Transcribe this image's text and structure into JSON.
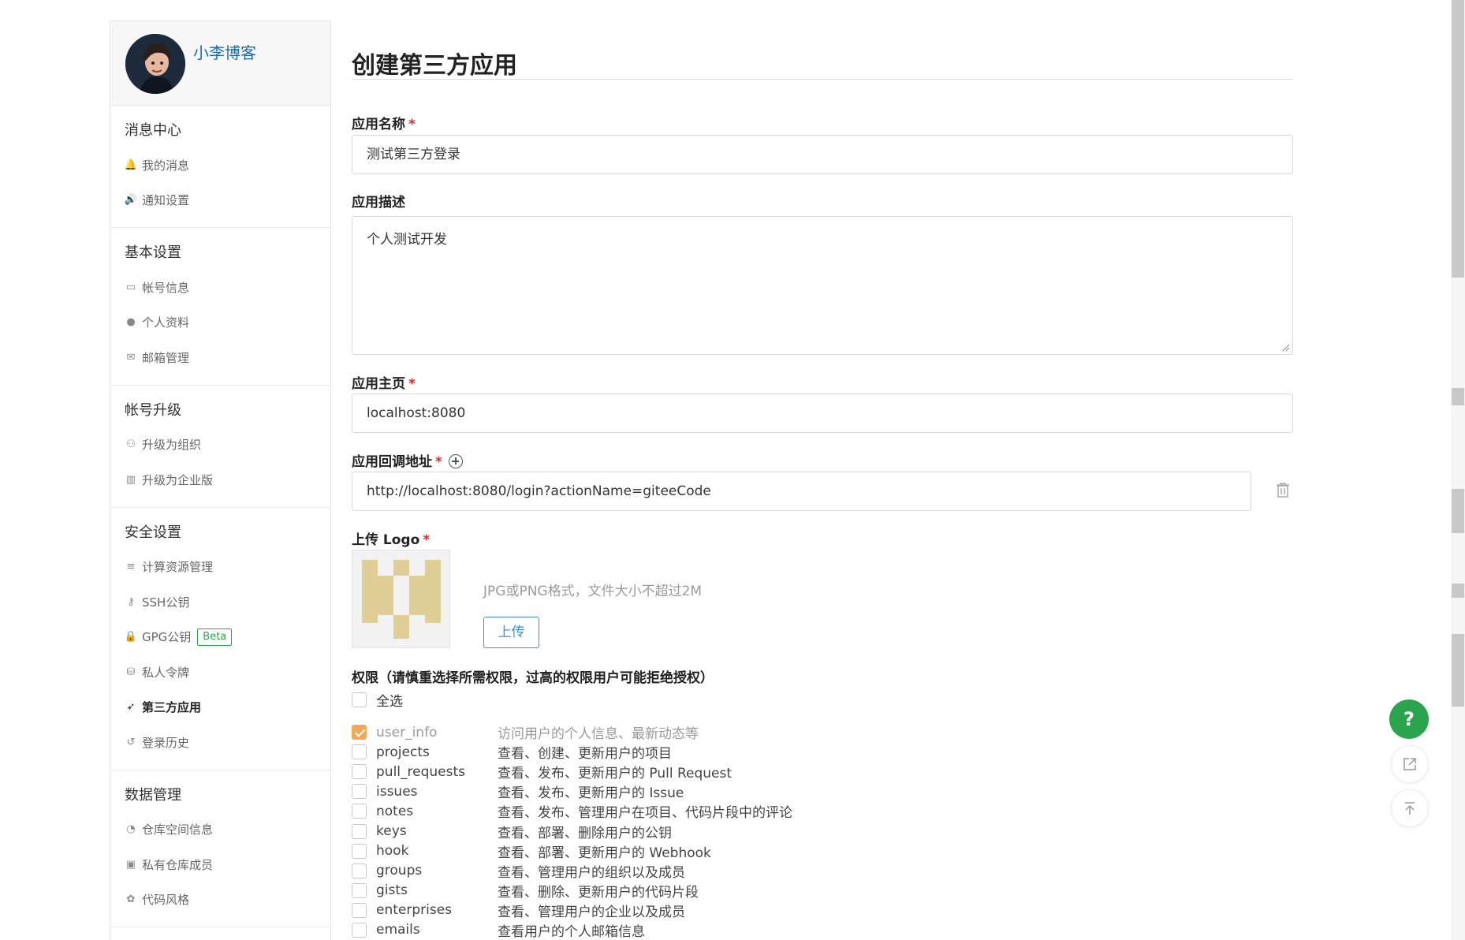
{
  "profile": {
    "username": "小李博客"
  },
  "sidebar": {
    "groups": [
      {
        "title": "消息中心",
        "items": [
          {
            "label": "我的消息",
            "icon": "bell-icon"
          },
          {
            "label": "通知设置",
            "icon": "speaker-icon"
          }
        ]
      },
      {
        "title": "基本设置",
        "items": [
          {
            "label": "帐号信息",
            "icon": "id-card-icon"
          },
          {
            "label": "个人资料",
            "icon": "user-icon"
          },
          {
            "label": "邮箱管理",
            "icon": "envelope-icon"
          }
        ]
      },
      {
        "title": "帐号升级",
        "items": [
          {
            "label": "升级为组织",
            "icon": "users-icon"
          },
          {
            "label": "升级为企业版",
            "icon": "building-icon"
          }
        ]
      },
      {
        "title": "安全设置",
        "items": [
          {
            "label": "计算资源管理",
            "icon": "list-icon"
          },
          {
            "label": "SSH公钥",
            "icon": "key-icon"
          },
          {
            "label": "GPG公钥",
            "icon": "lock-icon",
            "badge": "Beta"
          },
          {
            "label": "私人令牌",
            "icon": "token-icon"
          },
          {
            "label": "第三方应用",
            "icon": "rocket-icon",
            "active": true
          },
          {
            "label": "登录历史",
            "icon": "history-icon"
          }
        ]
      },
      {
        "title": "数据管理",
        "items": [
          {
            "label": "仓库空间信息",
            "icon": "pie-chart-icon"
          },
          {
            "label": "私有仓库成员",
            "icon": "badge-icon"
          },
          {
            "label": "代码风格",
            "icon": "palette-icon"
          }
        ]
      }
    ]
  },
  "main": {
    "title": "创建第三方应用",
    "app_name": {
      "label": "应用名称",
      "required": "*",
      "value": "测试第三方登录"
    },
    "app_desc": {
      "label": "应用描述",
      "value": "个人测试开发"
    },
    "homepage": {
      "label": "应用主页",
      "required": "*",
      "value": "localhost:8080"
    },
    "callback": {
      "label": "应用回调地址",
      "required": "*",
      "value": "http://localhost:8080/login?actionName=giteeCode"
    },
    "logo": {
      "label": "上传 Logo",
      "required": "*",
      "hint": "JPG或PNG格式，文件大小不超过2M",
      "upload_label": "上传"
    },
    "permissions": {
      "title": "权限（请慎重选择所需权限，过高的权限用户可能拒绝授权）",
      "select_all": "全选",
      "scopes": [
        {
          "name": "user_info",
          "desc": "访问用户的个人信息、最新动态等",
          "checked": true
        },
        {
          "name": "projects",
          "desc": "查看、创建、更新用户的项目",
          "checked": false
        },
        {
          "name": "pull_requests",
          "desc": "查看、发布、更新用户的 Pull Request",
          "checked": false
        },
        {
          "name": "issues",
          "desc": "查看、发布、更新用户的 Issue",
          "checked": false
        },
        {
          "name": "notes",
          "desc": "查看、发布、管理用户在项目、代码片段中的评论",
          "checked": false
        },
        {
          "name": "keys",
          "desc": "查看、部署、删除用户的公钥",
          "checked": false
        },
        {
          "name": "hook",
          "desc": "查看、部署、更新用户的 Webhook",
          "checked": false
        },
        {
          "name": "groups",
          "desc": "查看、管理用户的组织以及成员",
          "checked": false
        },
        {
          "name": "gists",
          "desc": "查看、删除、更新用户的代码片段",
          "checked": false
        },
        {
          "name": "enterprises",
          "desc": "查看、管理用户的企业以及成员",
          "checked": false
        },
        {
          "name": "emails",
          "desc": "查看用户的个人邮箱信息",
          "checked": false
        }
      ]
    }
  },
  "floating": {
    "help": "?",
    "help_icon": "question-icon",
    "share_icon": "external-link-icon",
    "top_icon": "back-to-top-icon"
  },
  "colors": {
    "accent_green": "#2aa54d",
    "link_blue": "#1f6aa5",
    "button_blue": "#3d8bd9",
    "checked_orange": "#f0a95c",
    "required_red": "#d0302e"
  }
}
